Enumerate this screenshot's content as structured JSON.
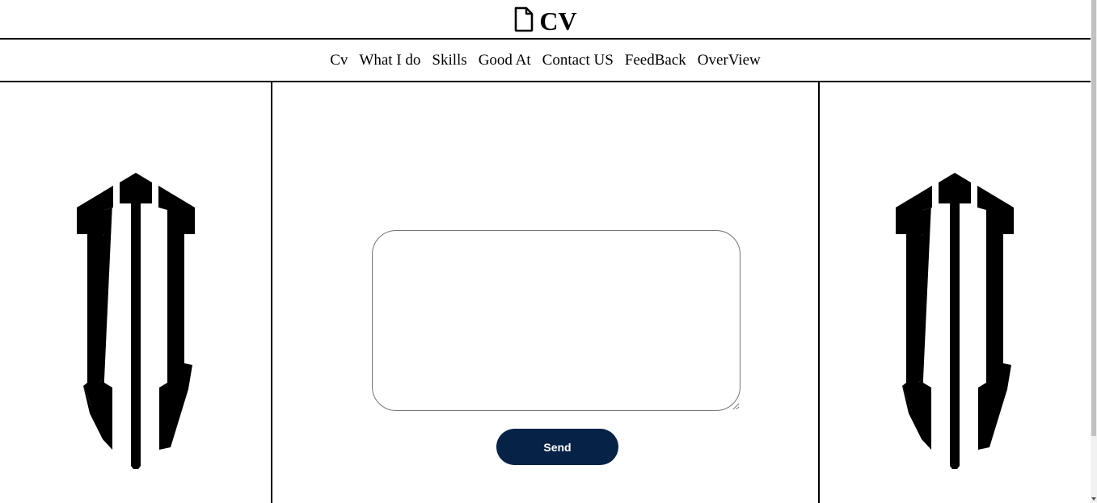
{
  "header": {
    "icon": "file-icon",
    "title": "CV"
  },
  "nav": {
    "items": [
      {
        "label": "Cv"
      },
      {
        "label": "What I do"
      },
      {
        "label": "Skills"
      },
      {
        "label": "Good At"
      },
      {
        "label": "Contact US"
      },
      {
        "label": "FeedBack"
      },
      {
        "label": "OverView"
      }
    ]
  },
  "form": {
    "message_value": "",
    "send_label": "Send",
    "button_color": "#062347"
  },
  "logos": {
    "left": "trident-logo",
    "right": "trident-logo"
  }
}
